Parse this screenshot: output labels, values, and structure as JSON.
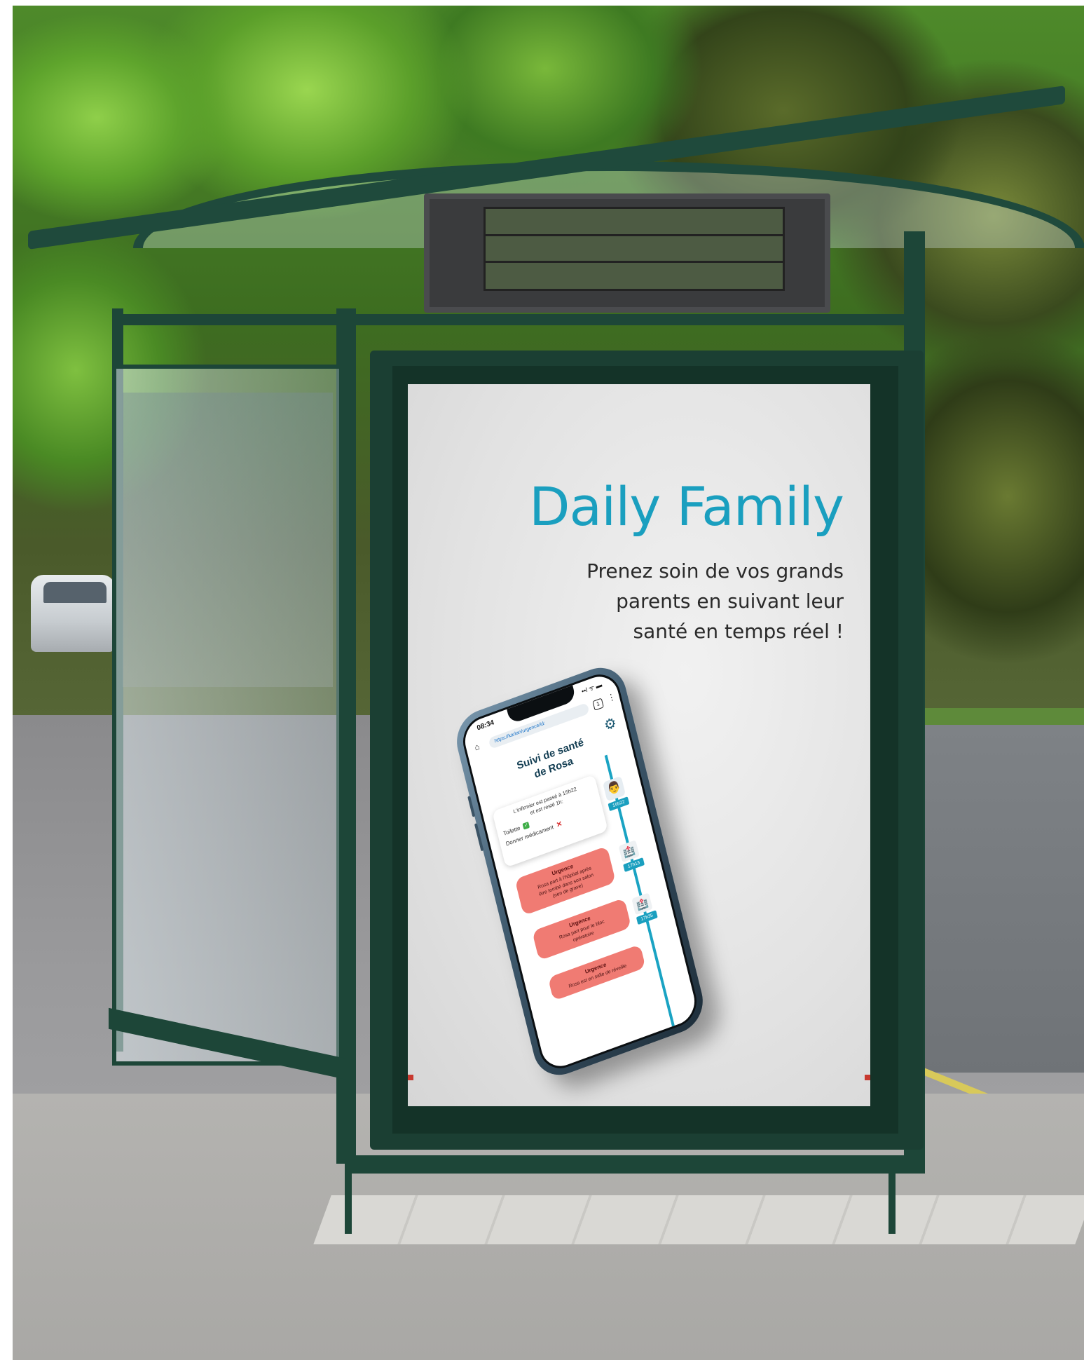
{
  "poster": {
    "title": "Daily Family",
    "tagline": "Prenez soin de vos grands\nparents en suivant leur\nsanté en temps réel !",
    "title_color": "#1a9fbf"
  },
  "phone": {
    "time": "08:34",
    "status": "••l ᯤ ▬",
    "url": "https://karlan/urgence/id:",
    "tabs_count": "1",
    "screen_title": "Suivi de santé\nde Rosa",
    "visit_card": {
      "text": "L'infirmier est passé à 15h22\net est resté 1h:",
      "tasks": [
        {
          "label": "Toilette",
          "done": true,
          "icon": "check-icon"
        },
        {
          "label": "Donner médicament",
          "done": false,
          "icon": "cross-icon"
        }
      ]
    },
    "timeline": [
      {
        "time": "15h22",
        "icon": "nurse-avatar-icon"
      },
      {
        "time": "17h13",
        "icon": "hospital-icon"
      },
      {
        "time": "17h35",
        "icon": "hospital-icon"
      }
    ],
    "urgences": [
      {
        "title": "Urgence",
        "text": "Rosa part à l'hôpital après\nêtre tombé dans son salon\n(rien de grave)"
      },
      {
        "title": "Urgence",
        "text": "Rosa part pour le bloc\nopératoire"
      },
      {
        "title": "Urgence",
        "text": "Rosa est en salle de réveille"
      }
    ],
    "accent_color": "#1aa3c3",
    "urgent_color": "#f07b73"
  }
}
